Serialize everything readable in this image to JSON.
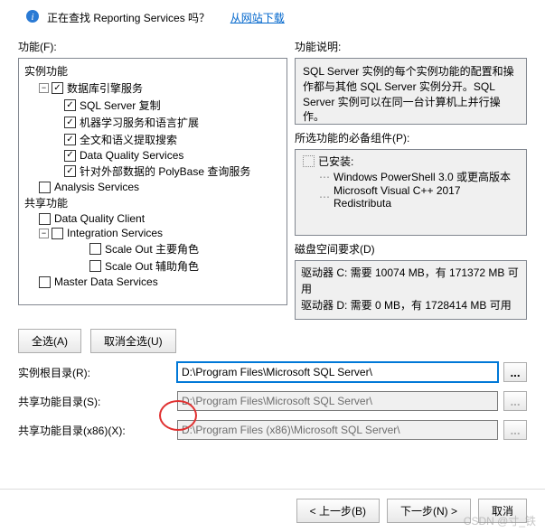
{
  "banner": {
    "text": "正在查找 Reporting Services 吗？",
    "link": "从网站下载"
  },
  "left": {
    "label": "功能(F):",
    "tree": {
      "header1": "实例功能",
      "db_engine": "数据库引擎服务",
      "replication": "SQL Server 复制",
      "ml": "机器学习服务和语言扩展",
      "fulltext": "全文和语义提取搜索",
      "dqs": "Data Quality Services",
      "polybase": "针对外部数据的 PolyBase 查询服务",
      "analysis": "Analysis Services",
      "header2": "共享功能",
      "dq_client": "Data Quality Client",
      "integration": "Integration Services",
      "scaleout_master": "Scale Out 主要角色",
      "scaleout_worker": "Scale Out 辅助角色",
      "master_data": "Master Data Services"
    },
    "select_all": "全选(A)",
    "deselect_all": "取消全选(U)"
  },
  "right": {
    "desc_label": "功能说明:",
    "desc_text": "SQL Server 实例的每个实例功能的配置和操作都与其他 SQL Server 实例分开。SQL Server 实例可以在同一台计算机上并行操作。",
    "prereq_label": "所选功能的必备组件(P):",
    "prereq_installed": "已安装:",
    "prereq_item1": "Windows PowerShell 3.0 或更高版本",
    "prereq_item2": "Microsoft Visual C++ 2017 Redistributa",
    "disk_label": "磁盘空间要求(D)",
    "disk_c": "驱动器 C: 需要 10074 MB，有 171372 MB 可用",
    "disk_d": "驱动器 D: 需要 0 MB，有 1728414 MB 可用"
  },
  "paths": {
    "root_label": "实例根目录(R):",
    "root_value": "D:\\Program Files\\Microsoft SQL Server\\",
    "shared_label": "共享功能目录(S):",
    "shared_value": "D:\\Program Files\\Microsoft SQL Server\\",
    "sharedx86_label": "共享功能目录(x86)(X):",
    "sharedx86_value": "D:\\Program Files (x86)\\Microsoft SQL Server\\",
    "browse": "..."
  },
  "buttons": {
    "back": "< 上一步(B)",
    "next": "下一步(N) >",
    "cancel": "取消"
  },
  "watermark": "CSDN @寸_铁"
}
